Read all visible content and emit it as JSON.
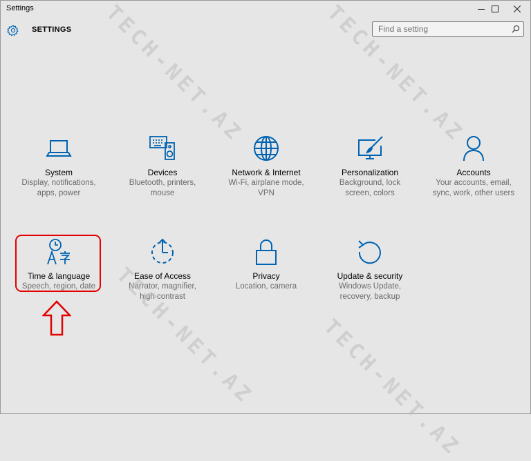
{
  "window": {
    "title": "Settings",
    "controls": [
      "minimize",
      "maximize",
      "close"
    ]
  },
  "header": {
    "title": "SETTINGS",
    "icon": "gear-icon"
  },
  "search": {
    "placeholder": "Find a setting",
    "icon": "search-icon"
  },
  "tiles": [
    {
      "id": "system",
      "icon": "laptop-icon",
      "title": "System",
      "desc_lines": [
        "Display, notifications,",
        "apps, power"
      ]
    },
    {
      "id": "devices",
      "icon": "keyboard-speaker-icon",
      "title": "Devices",
      "desc_lines": [
        "Bluetooth, printers,",
        "mouse"
      ]
    },
    {
      "id": "network",
      "icon": "globe-icon",
      "title": "Network & Internet",
      "desc_lines": [
        "Wi-Fi, airplane mode,",
        "VPN"
      ]
    },
    {
      "id": "personalization",
      "icon": "paintbrush-screen-icon",
      "title": "Personalization",
      "desc_lines": [
        "Background, lock",
        "screen, colors"
      ]
    },
    {
      "id": "accounts",
      "icon": "person-icon",
      "title": "Accounts",
      "desc_lines": [
        "Your accounts, email,",
        "sync, work, other users"
      ]
    },
    {
      "id": "time-language",
      "icon": "clock-language-icon",
      "title": "Time & language",
      "desc_lines": [
        "Speech, region, date"
      ]
    },
    {
      "id": "ease-of-access",
      "icon": "timer-dashed-icon",
      "title": "Ease of Access",
      "desc_lines": [
        "Narrator, magnifier,",
        "high contrast"
      ]
    },
    {
      "id": "privacy",
      "icon": "lock-icon",
      "title": "Privacy",
      "desc_lines": [
        "Location, camera"
      ]
    },
    {
      "id": "update-security",
      "icon": "refresh-icon",
      "title": "Update & security",
      "desc_lines": [
        "Windows Update,",
        "recovery, backup"
      ]
    }
  ],
  "annotation": {
    "highlight_target": "time-language",
    "highlight_color": "#e20000"
  },
  "watermark": {
    "text": "TECH-NET.AZ"
  },
  "colors": {
    "accent": "#0063b1",
    "background": "#e6e6e6",
    "annotation": "#e20000"
  }
}
